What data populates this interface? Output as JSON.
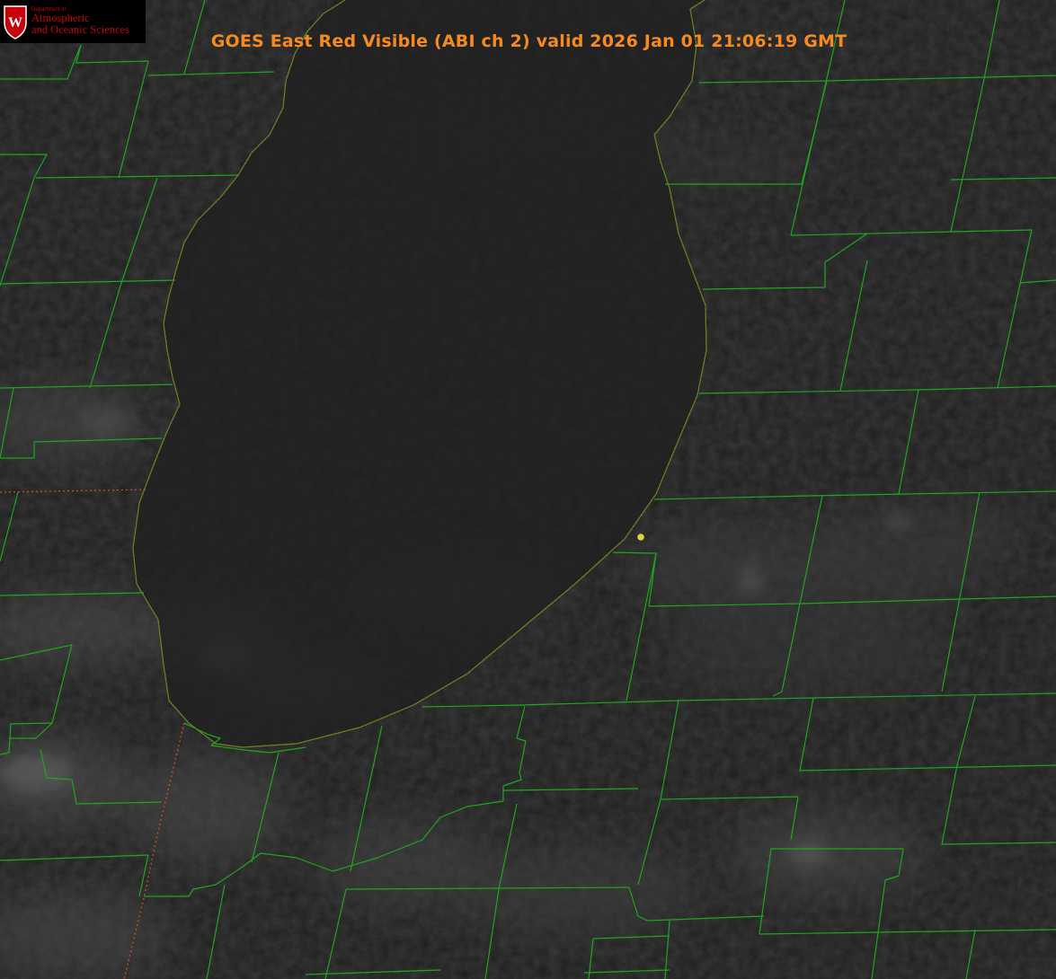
{
  "header": {
    "title": "GOES East Red Visible (ABI ch 2) valid 2026 Jan 01 21:06:19 GMT",
    "title_color": "#f58a1f"
  },
  "logo": {
    "department": "Department of",
    "line1": "Atmospheric",
    "line2": "and Oceanic Sciences",
    "seal_letter": "W",
    "brand_color": "#c5050c"
  },
  "map": {
    "background_color": "#1b1b1b",
    "county_line_color": "#1fa51f",
    "state_border_color": "#d3482a",
    "marker_color": "#d9d63a",
    "layers": [
      "satellite-visible",
      "county-boundaries",
      "state-border",
      "lake-shoreline",
      "station-marker"
    ]
  }
}
